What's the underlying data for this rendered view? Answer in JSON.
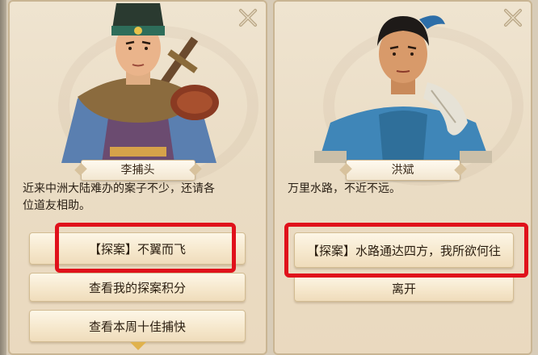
{
  "left_dialog": {
    "npc_name": "李捕头",
    "speech_line1": "近来中洲大陆难办的案子不少，还请各",
    "speech_line2": "位道友相助。",
    "options": [
      "【探案】不翼而飞",
      "查看我的探案积分",
      "查看本周十佳捕快"
    ]
  },
  "right_dialog": {
    "npc_name": "洪斌",
    "speech_line1": "万里水路，不近不远。",
    "options": [
      "【探案】水路通达四方，我所欲何往",
      "离开"
    ]
  },
  "colors": {
    "highlight": "#e0111b",
    "panel_bg": "#efe4d0",
    "button_bg": "#f6e8cd"
  },
  "icons": [
    "close-icon",
    "more-options-arrow-icon"
  ]
}
